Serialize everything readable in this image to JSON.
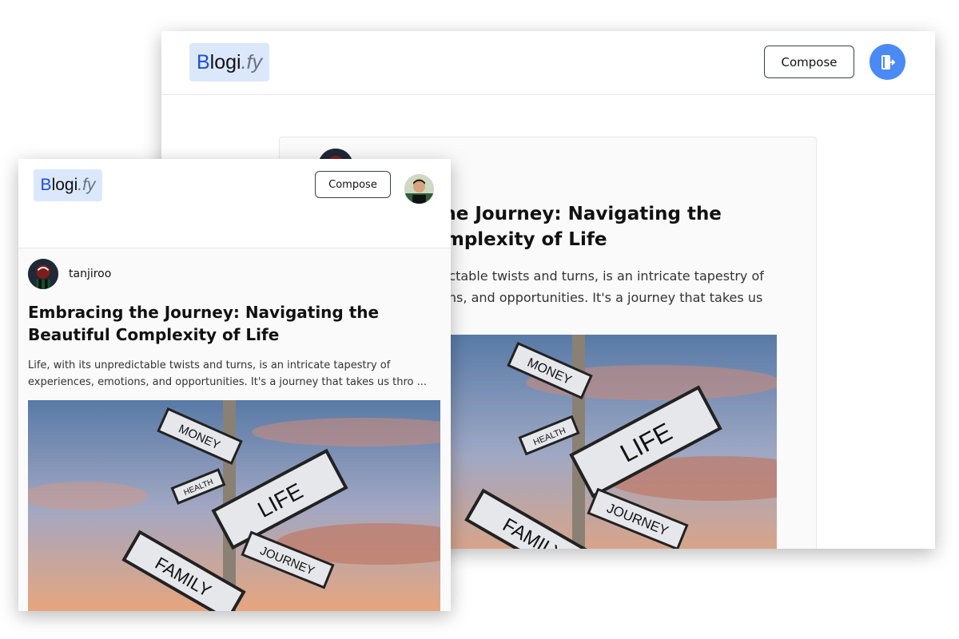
{
  "app": {
    "logo_first": "B",
    "logo_mid": "logi",
    "logo_suffix": ".fy",
    "compose_label": "Compose"
  },
  "post": {
    "author": "tanjiroo",
    "title": "Embracing the Journey: Navigating the Beautiful Complexity of Life",
    "excerpt": "Life, with its unpredictable twists and turns, is an intricate tapestry of experiences, emotions, and opportunities. It's a journey that takes us thro ...",
    "image_signs": [
      "MONEY",
      "HEALTH",
      "LIFE",
      "FAMILY",
      "JOURNEY"
    ]
  },
  "icons": {
    "logout": "logout-icon",
    "user_avatar": "user-avatar",
    "author_avatar": "author-avatar"
  },
  "colors": {
    "accent": "#4a8af4",
    "logo_bg": "#dbe7fb",
    "logo_b": "#1d4ed8"
  }
}
